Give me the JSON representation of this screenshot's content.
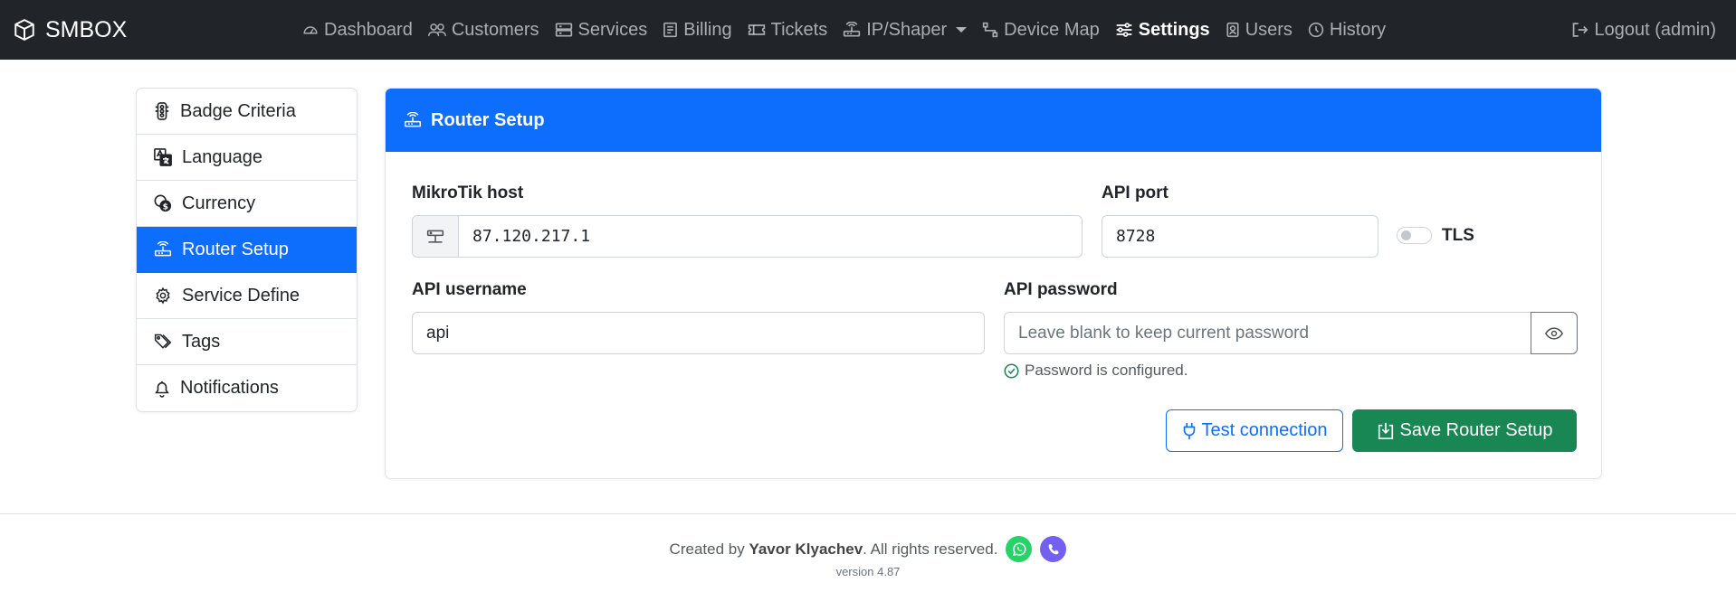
{
  "brand": {
    "name": "SMBOX",
    "icon": "box-icon"
  },
  "nav": {
    "items": [
      {
        "label": "Dashboard",
        "icon": "speedometer-icon"
      },
      {
        "label": "Customers",
        "icon": "people-icon"
      },
      {
        "label": "Services",
        "icon": "server-icon"
      },
      {
        "label": "Billing",
        "icon": "receipt-icon"
      },
      {
        "label": "Tickets",
        "icon": "ticket-icon"
      },
      {
        "label": "IP/Shaper",
        "icon": "router-icon"
      },
      {
        "label": "Device Map",
        "icon": "diagram-icon"
      },
      {
        "label": "Settings",
        "icon": "sliders-icon"
      },
      {
        "label": "Users",
        "icon": "person-badge-icon"
      },
      {
        "label": "History",
        "icon": "clock-icon"
      }
    ],
    "active": "Settings",
    "logout": "Logout (admin)"
  },
  "sidebar": {
    "items": [
      {
        "label": "Badge Criteria",
        "icon": "traffic-light-icon"
      },
      {
        "label": "Language",
        "icon": "translate-icon"
      },
      {
        "label": "Currency",
        "icon": "coin-icon"
      },
      {
        "label": "Router Setup",
        "icon": "router-icon"
      },
      {
        "label": "Service Define",
        "icon": "gear-icon"
      },
      {
        "label": "Tags",
        "icon": "tags-icon"
      },
      {
        "label": "Notifications",
        "icon": "bell-icon"
      }
    ],
    "active": "Router Setup"
  },
  "card": {
    "title": "Router Setup",
    "host_label": "MikroTik host",
    "host_value": "87.120.217.1",
    "port_label": "API port",
    "port_value": "8728",
    "tls_label": "TLS",
    "tls_enabled": false,
    "username_label": "API username",
    "username_value": "api",
    "password_label": "API password",
    "password_placeholder": "Leave blank to keep current password",
    "password_status": "Password is configured.",
    "test_button": "Test connection",
    "save_button": "Save Router Setup"
  },
  "footer": {
    "created_by": "Created by",
    "author": "Yavor Klyachev",
    "rights": ". All rights reserved.",
    "version": "version 4.87"
  },
  "colors": {
    "navbar": "#212529",
    "primary": "#0d6efd",
    "success": "#198754",
    "whatsapp": "#25d366",
    "viber": "#7360f2"
  }
}
